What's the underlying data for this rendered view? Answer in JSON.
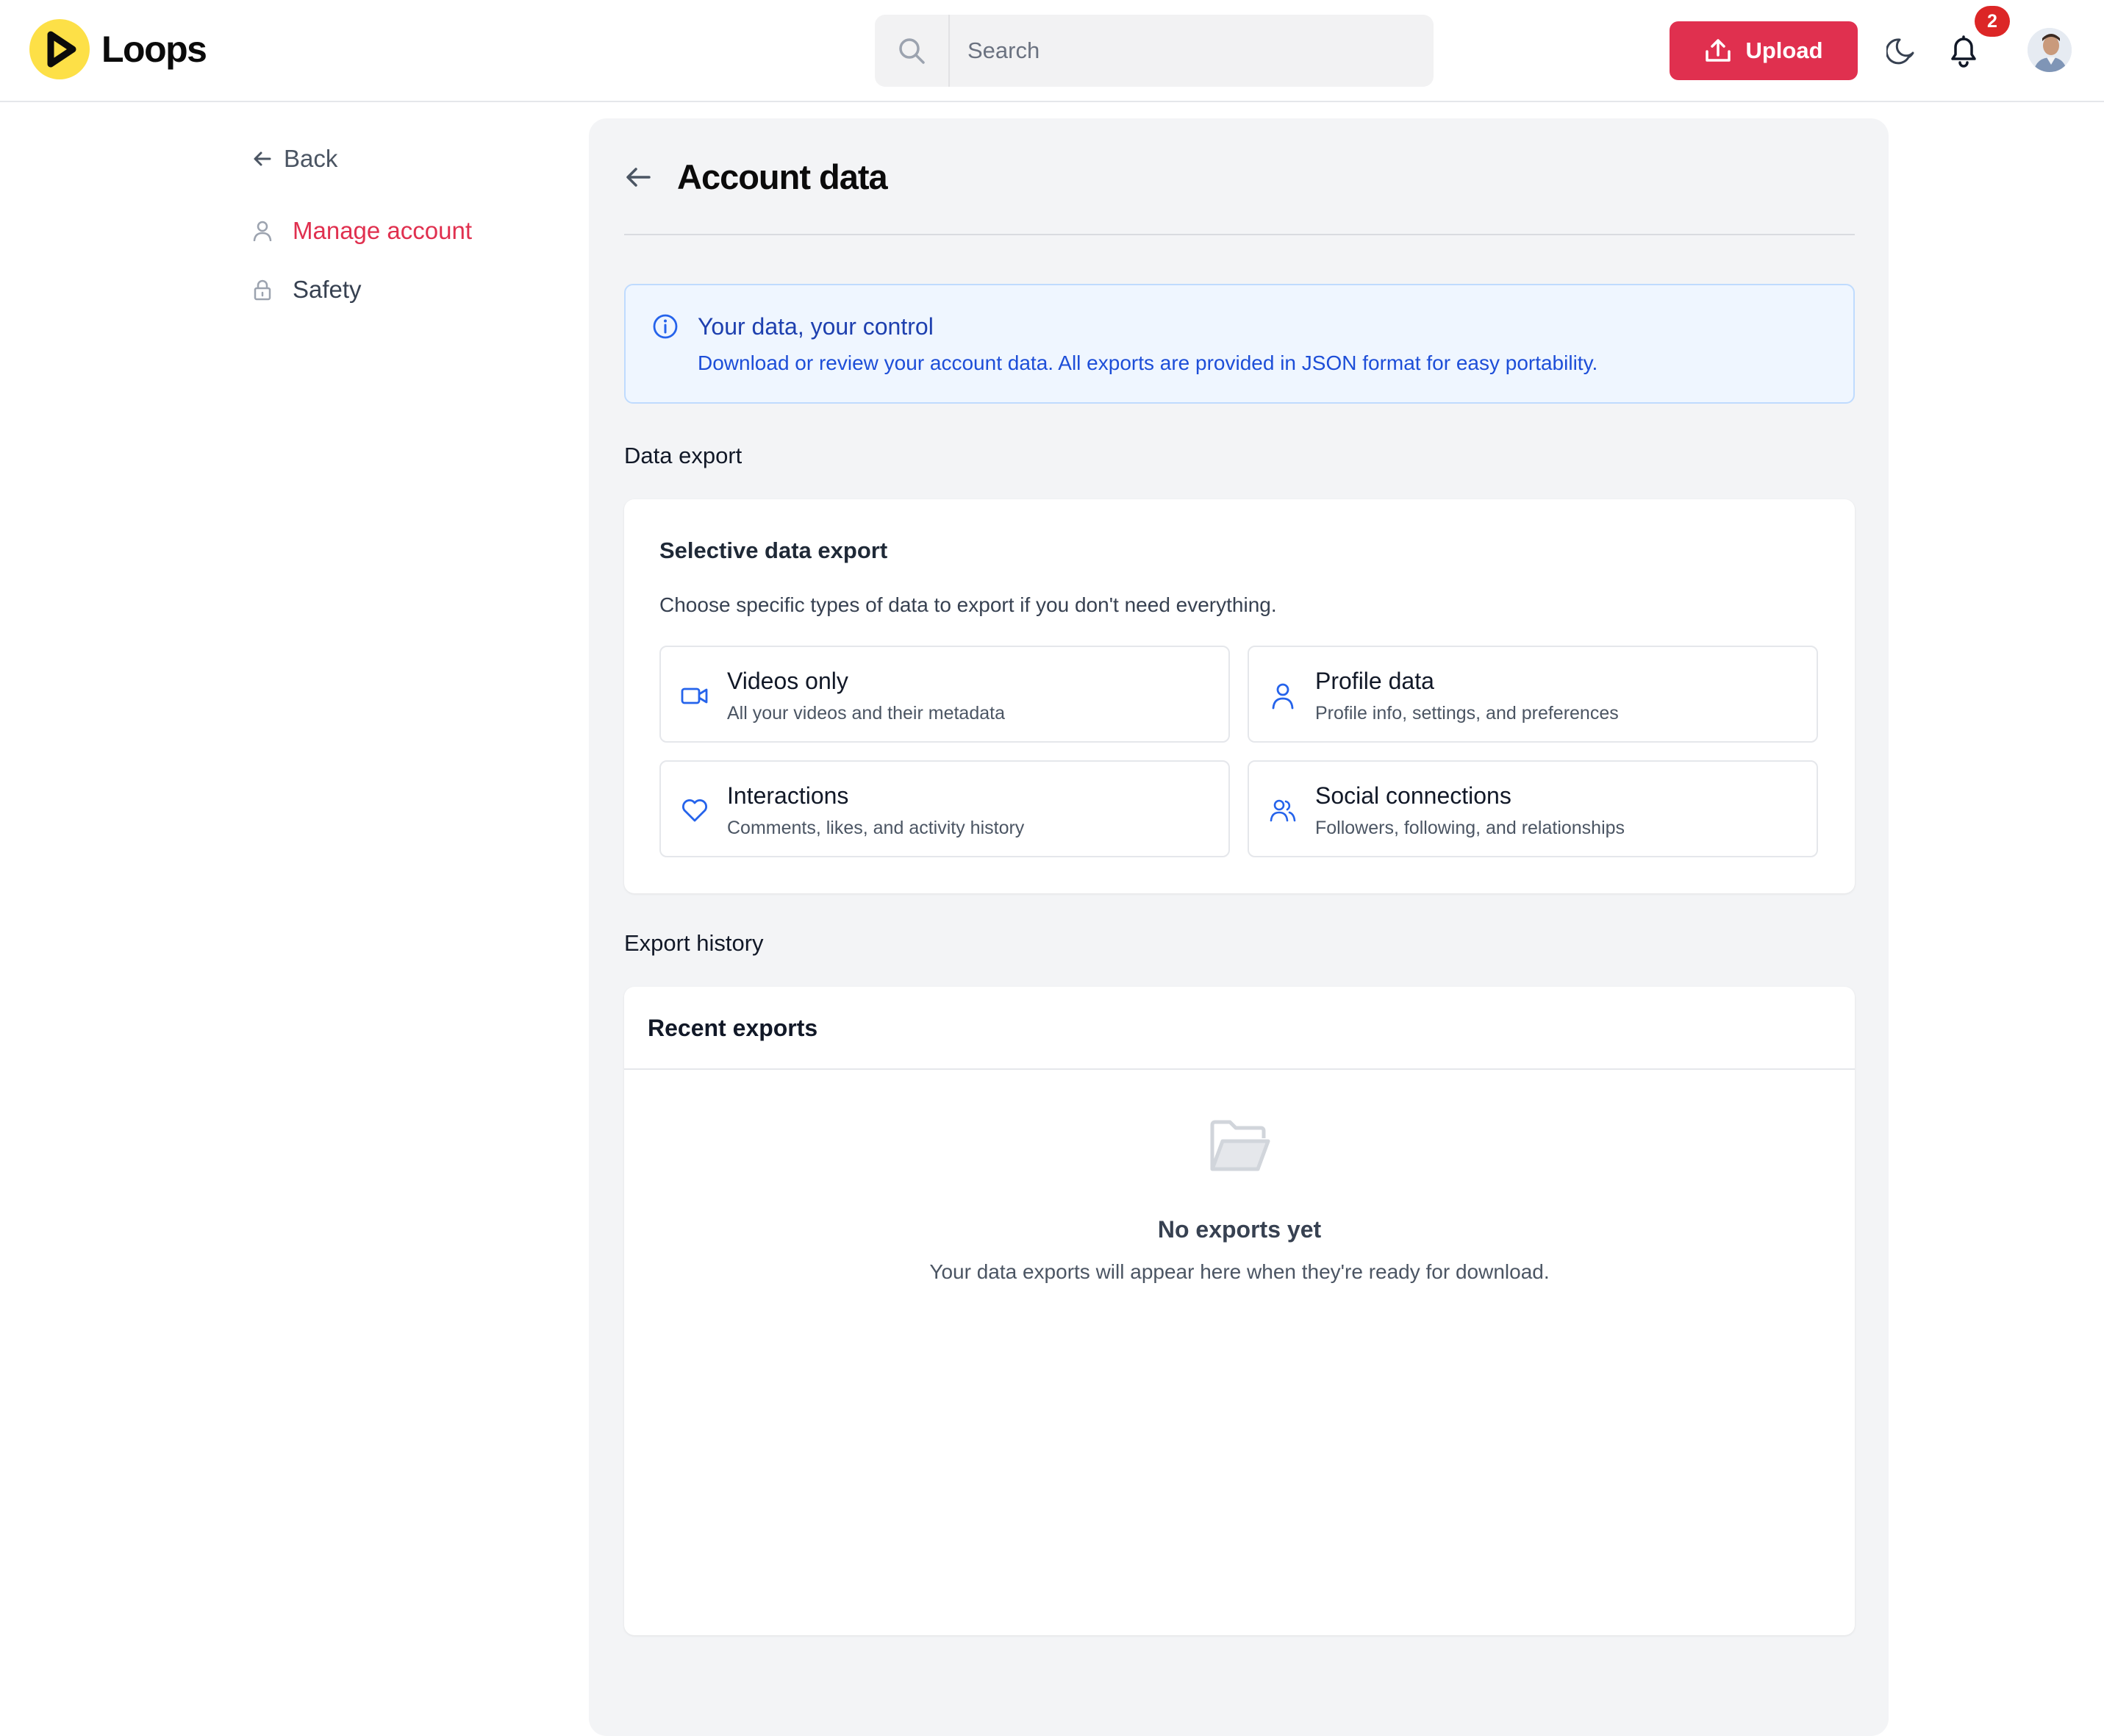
{
  "app": {
    "name": "Loops"
  },
  "colors": {
    "accent": "#e0304f",
    "link_blue": "#1d4ed8",
    "badge_red": "#dc2626",
    "logo_yellow": "#fde047"
  },
  "header": {
    "search_placeholder": "Search",
    "upload_label": "Upload",
    "notification_count": "2",
    "icons": [
      "search-icon",
      "upload-icon",
      "moon-icon",
      "bell-icon"
    ]
  },
  "sidebar": {
    "back_label": "Back",
    "items": [
      {
        "label": "Manage account",
        "icon": "user-icon",
        "active": true
      },
      {
        "label": "Safety",
        "icon": "lock-icon",
        "active": false
      }
    ]
  },
  "page": {
    "title": "Account data",
    "info": {
      "title": "Your data, your control",
      "body": "Download or review your account data. All exports are provided in JSON format for easy portability."
    },
    "data_export": {
      "section_label": "Data export",
      "card_title": "Selective data export",
      "card_description": "Choose specific types of data to export if you don't need everything.",
      "options": [
        {
          "title": "Videos only",
          "description": "All your videos and their metadata",
          "icon": "video-icon"
        },
        {
          "title": "Profile data",
          "description": "Profile info, settings, and preferences",
          "icon": "user-icon"
        },
        {
          "title": "Interactions",
          "description": "Comments, likes, and activity history",
          "icon": "heart-icon"
        },
        {
          "title": "Social connections",
          "description": "Followers, following, and relationships",
          "icon": "users-icon"
        }
      ]
    },
    "export_history": {
      "section_label": "Export history",
      "card_title": "Recent exports",
      "empty_title": "No exports yet",
      "empty_description": "Your data exports will appear here when they're ready for download."
    }
  }
}
